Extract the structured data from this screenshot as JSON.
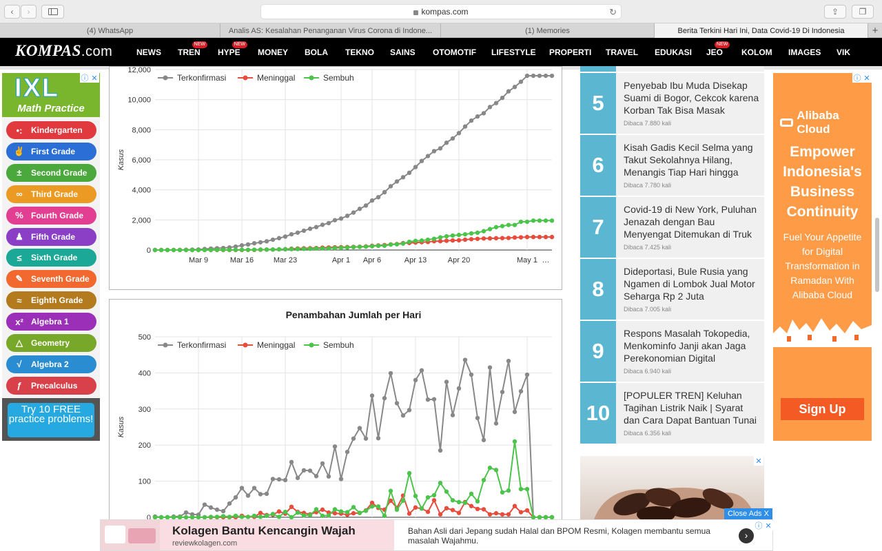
{
  "browser": {
    "url": "kompas.com",
    "tabs": [
      "(4) WhatsApp",
      "Analis AS: Kesalahan Penanganan Virus Corona di Indone...",
      "(1) Memories",
      "Berita Terkini Hari Ini, Data Covid-19 Di Indonesia"
    ],
    "new_tab": "+"
  },
  "site": {
    "logo_main": "KOMPAS",
    "logo_suffix": ".com",
    "nav": [
      {
        "label": "NEWS",
        "badge": ""
      },
      {
        "label": "TREN",
        "badge": "NEW"
      },
      {
        "label": "HYPE",
        "badge": "NEW"
      },
      {
        "label": "MONEY",
        "badge": ""
      },
      {
        "label": "BOLA",
        "badge": ""
      },
      {
        "label": "TEKNO",
        "badge": ""
      },
      {
        "label": "SAINS",
        "badge": ""
      },
      {
        "label": "OTOMOTIF",
        "badge": ""
      },
      {
        "label": "LIFESTYLE",
        "badge": ""
      },
      {
        "label": "PROPERTI",
        "badge": ""
      },
      {
        "label": "TRAVEL",
        "badge": ""
      },
      {
        "label": "EDUKASI",
        "badge": ""
      },
      {
        "label": "JEO",
        "badge": "NEW"
      },
      {
        "label": "KOLOM",
        "badge": ""
      },
      {
        "label": "IMAGES",
        "badge": ""
      },
      {
        "label": "VIK",
        "badge": ""
      }
    ]
  },
  "left_ad": {
    "brand": "IXL",
    "subtitle": "Math Practice",
    "items": [
      {
        "label": "Kindergarten",
        "icon": "dots-icon",
        "glyph": "•:",
        "color": "#e0393e"
      },
      {
        "label": "First Grade",
        "icon": "hand-icon",
        "glyph": "✌",
        "color": "#2b6fd6"
      },
      {
        "label": "Second Grade",
        "icon": "plus-minus-icon",
        "glyph": "±",
        "color": "#4aa83c"
      },
      {
        "label": "Third Grade",
        "icon": "infinity-icon",
        "glyph": "∞",
        "color": "#eb9a23"
      },
      {
        "label": "Fourth Grade",
        "icon": "percent-icon",
        "glyph": "%",
        "color": "#e23f92"
      },
      {
        "label": "Fifth Grade",
        "icon": "stamp-icon",
        "glyph": "♟",
        "color": "#8a3fc6"
      },
      {
        "label": "Sixth Grade",
        "icon": "less-equal-icon",
        "glyph": "≤",
        "color": "#1ba896"
      },
      {
        "label": "Seventh Grade",
        "icon": "pencil-icon",
        "glyph": "✎",
        "color": "#f2692f"
      },
      {
        "label": "Eighth Grade",
        "icon": "approx-icon",
        "glyph": "≈",
        "color": "#b47b1e"
      },
      {
        "label": "Algebra 1",
        "icon": "x-squared-icon",
        "glyph": "x²",
        "color": "#9b2fb8"
      },
      {
        "label": "Geometry",
        "icon": "triangle-icon",
        "glyph": "△",
        "color": "#78a82a"
      },
      {
        "label": "Algebra 2",
        "icon": "sqrt-icon",
        "glyph": "√",
        "color": "#2a8dd2"
      },
      {
        "label": "Precalculus",
        "icon": "function-icon",
        "glyph": "ƒ",
        "color": "#d9414a"
      }
    ],
    "cta": "Try 10 FREE practice problems!"
  },
  "charts": {
    "chart1": {
      "title": ""
    },
    "chart2": {
      "title": "Penambahan Jumlah per Hari"
    }
  },
  "chart_data": [
    {
      "type": "line",
      "title": "",
      "xlabel": "",
      "ylabel": "Kasus",
      "ylim": [
        0,
        12000
      ],
      "yticks": [
        0,
        2000,
        4000,
        6000,
        8000,
        10000,
        12000
      ],
      "ytick_labels": [
        "0",
        "2,000",
        "4,000",
        "6,000",
        "8,000",
        "10,000",
        "12,000"
      ],
      "xtick_labels": [
        "Mar 9",
        "Mar 16",
        "Mar 23",
        "Apr 1",
        "Apr 6",
        "Apr 13",
        "Apr 20",
        "May 1",
        "…"
      ],
      "xtick_index": [
        7,
        14,
        21,
        30,
        35,
        42,
        49,
        60,
        63
      ],
      "legend_position": "top-left",
      "grid": true,
      "n_points": 65,
      "series": [
        {
          "name": "Terkonfirmasi",
          "color": "#888888",
          "values": [
            2,
            2,
            2,
            4,
            6,
            19,
            27,
            34,
            69,
            96,
            117,
            134,
            172,
            227,
            309,
            369,
            450,
            514,
            579,
            686,
            790,
            893,
            1046,
            1155,
            1285,
            1414,
            1528,
            1677,
            1790,
            1986,
            2092,
            2273,
            2491,
            2738,
            2956,
            3293,
            3512,
            3842,
            4241,
            4557,
            4839,
            5136,
            5516,
            5923,
            6248,
            6575,
            6760,
            7135,
            7418,
            7775,
            8211,
            8607,
            8882,
            9096,
            9511,
            9771,
            10118,
            10551,
            10843,
            11192,
            11587,
            11587,
            11587,
            11587,
            11587
          ]
        },
        {
          "name": "Meninggal",
          "color": "#e74c3c",
          "values": [
            0,
            0,
            0,
            0,
            0,
            0,
            0,
            0,
            0,
            0,
            0,
            0,
            0,
            0,
            0,
            5,
            7,
            19,
            25,
            32,
            48,
            58,
            87,
            102,
            114,
            122,
            136,
            157,
            170,
            181,
            191,
            198,
            209,
            221,
            240,
            280,
            306,
            327,
            373,
            399,
            459,
            469,
            496,
            520,
            535,
            582,
            590,
            615,
            635,
            647,
            689,
            720,
            743,
            765,
            773,
            784,
            792,
            800,
            831,
            845,
            864,
            864,
            864,
            864,
            864
          ]
        },
        {
          "name": "Sembuh",
          "color": "#4cc44c",
          "values": [
            0,
            0,
            0,
            0,
            0,
            0,
            0,
            0,
            2,
            3,
            7,
            8,
            9,
            11,
            15,
            16,
            20,
            29,
            30,
            31,
            46,
            46,
            59,
            64,
            75,
            81,
            103,
            107,
            112,
            134,
            150,
            164,
            192,
            204,
            222,
            252,
            282,
            286,
            359,
            380,
            426,
            548,
            607,
            631,
            686,
            747,
            842,
            913,
            960,
            1002,
            1042,
            1107,
            1151,
            1254,
            1391,
            1522,
            1591,
            1665,
            1665,
            1876,
            1876,
            1954,
            1954,
            1954,
            1954
          ]
        }
      ]
    },
    {
      "type": "line",
      "title": "Penambahan Jumlah per Hari",
      "xlabel": "",
      "ylabel": "Kasus",
      "ylim": [
        0,
        500
      ],
      "yticks": [
        0,
        100,
        200,
        300,
        400,
        500
      ],
      "ytick_labels": [
        "0",
        "100",
        "200",
        "300",
        "400",
        "500"
      ],
      "legend_position": "top-left",
      "grid": true,
      "n_points": 65,
      "series": [
        {
          "name": "Terkonfirmasi",
          "color": "#888888",
          "values": [
            2,
            0,
            0,
            2,
            2,
            13,
            8,
            7,
            35,
            27,
            21,
            17,
            38,
            55,
            81,
            60,
            81,
            64,
            65,
            106,
            105,
            103,
            153,
            109,
            130,
            129,
            114,
            149,
            113,
            196,
            106,
            181,
            218,
            247,
            218,
            337,
            219,
            330,
            399,
            316,
            282,
            297,
            380,
            407,
            326,
            327,
            185,
            375,
            283,
            357,
            436,
            395,
            275,
            214,
            415,
            260,
            347,
            433,
            292,
            349,
            395,
            0,
            0,
            0,
            0
          ]
        },
        {
          "name": "Meninggal",
          "color": "#e74c3c",
          "values": [
            0,
            0,
            0,
            0,
            0,
            0,
            0,
            0,
            0,
            0,
            0,
            0,
            0,
            0,
            4,
            1,
            1,
            12,
            6,
            7,
            16,
            10,
            29,
            15,
            12,
            8,
            14,
            21,
            13,
            11,
            10,
            7,
            11,
            12,
            19,
            40,
            26,
            21,
            46,
            26,
            60,
            10,
            27,
            24,
            15,
            47,
            8,
            25,
            20,
            12,
            42,
            31,
            23,
            22,
            8,
            11,
            8,
            8,
            31,
            14,
            19,
            0,
            0,
            0,
            0
          ]
        },
        {
          "name": "Sembuh",
          "color": "#4cc44c",
          "values": [
            0,
            0,
            0,
            0,
            0,
            0,
            0,
            0,
            0,
            1,
            1,
            3,
            1,
            4,
            1,
            1,
            4,
            1,
            4,
            9,
            1,
            15,
            0,
            13,
            5,
            6,
            22,
            4,
            5,
            22,
            16,
            14,
            28,
            12,
            18,
            30,
            30,
            4,
            73,
            21,
            46,
            122,
            59,
            24,
            55,
            61,
            95,
            71,
            47,
            42,
            40,
            65,
            44,
            103,
            137,
            131,
            69,
            74,
            210,
            78,
            78,
            0,
            0,
            0,
            0
          ]
        }
      ]
    }
  ],
  "popular": [
    {
      "rank": "5",
      "title": "Penyebab Ibu Muda Disekap Suami di Bogor, Cekcok karena Korban Tak Bisa Masak",
      "views": "Dibaca 7.880 kali"
    },
    {
      "rank": "6",
      "title": "Kisah Gadis Kecil Selma yang Takut Sekolahnya Hilang, Menangis Tiap Hari hingga",
      "views": "Dibaca 7.780 kali"
    },
    {
      "rank": "7",
      "title": "Covid-19 di New York, Puluhan Jenazah dengan Bau Menyengat Ditemukan di Truk",
      "views": "Dibaca 7.425 kali"
    },
    {
      "rank": "8",
      "title": "Dideportasi, Bule Rusia yang Ngamen di Lombok Jual Motor Seharga Rp 2 Juta",
      "views": "Dibaca 7.005 kali"
    },
    {
      "rank": "9",
      "title": "Respons Masalah Tokopedia, Menkominfo Janji akan Jaga Perekonomian Digital",
      "views": "Dibaca 6.940 kali"
    },
    {
      "rank": "10",
      "title": "[POPULER TREN] Keluhan Tagihan Listrik Naik | Syarat dan Cara Dapat Bantuan Tunai",
      "views": "Dibaca 6.356 kali"
    }
  ],
  "right_ad": {
    "brand": "Alibaba Cloud",
    "headline": "Empower Indonesia's Business Continuity",
    "body": "Fuel Your Appetite for Digital Transformation in Ramadan With Alibaba Cloud",
    "cta": "Sign Up"
  },
  "close_ads": "Close Ads X",
  "bottom_ad": {
    "title": "Kolagen Bantu Kencangin Wajah",
    "domain": "reviewkolagen.com",
    "description": "Bahan Asli dari Jepang sudah Halal dan BPOM Resmi, Kolagen membantu semua masalah Wajahmu."
  }
}
